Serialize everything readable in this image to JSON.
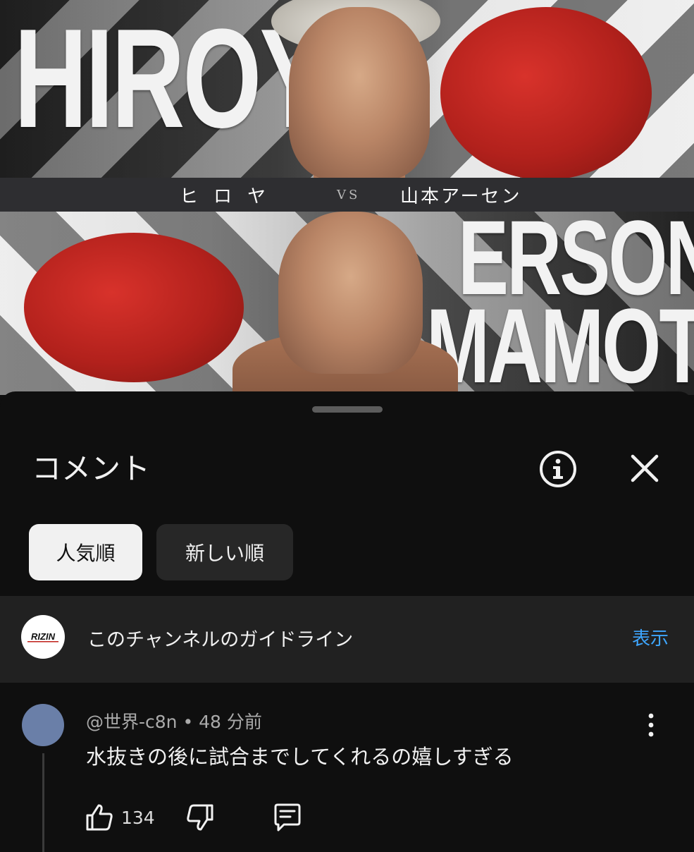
{
  "thumbnail": {
    "name_top": "HIROYA",
    "name_bottom_line1": "ERSON",
    "name_bottom_line2": "MAMOTO",
    "vs_left": "ヒロヤ",
    "vs_mid": "VS",
    "vs_right": "山本アーセン"
  },
  "sheet": {
    "title": "コメント",
    "info_icon": "info-circle-icon",
    "close_icon": "close-icon"
  },
  "sort_chips": [
    {
      "label": "人気順",
      "selected": true
    },
    {
      "label": "新しい順",
      "selected": false
    }
  ],
  "guideline": {
    "logo_text": "RIZIN",
    "text": "このチャンネルのガイドライン",
    "action": "表示"
  },
  "comment": {
    "meta": "@世界-c8n • 48 分前",
    "text": "水抜きの後に試合までしてくれるの嬉しすぎる",
    "likes": "134",
    "icons": [
      "thumbs-up-icon",
      "thumbs-down-icon",
      "reply-icon",
      "more-vert-icon"
    ]
  },
  "colors": {
    "background": "#0f0f0f",
    "accent_link": "#3ea6ff",
    "guideline_bg": "#212121",
    "chip_selected_bg": "#f1f1f1",
    "chip_bg": "#272727"
  }
}
